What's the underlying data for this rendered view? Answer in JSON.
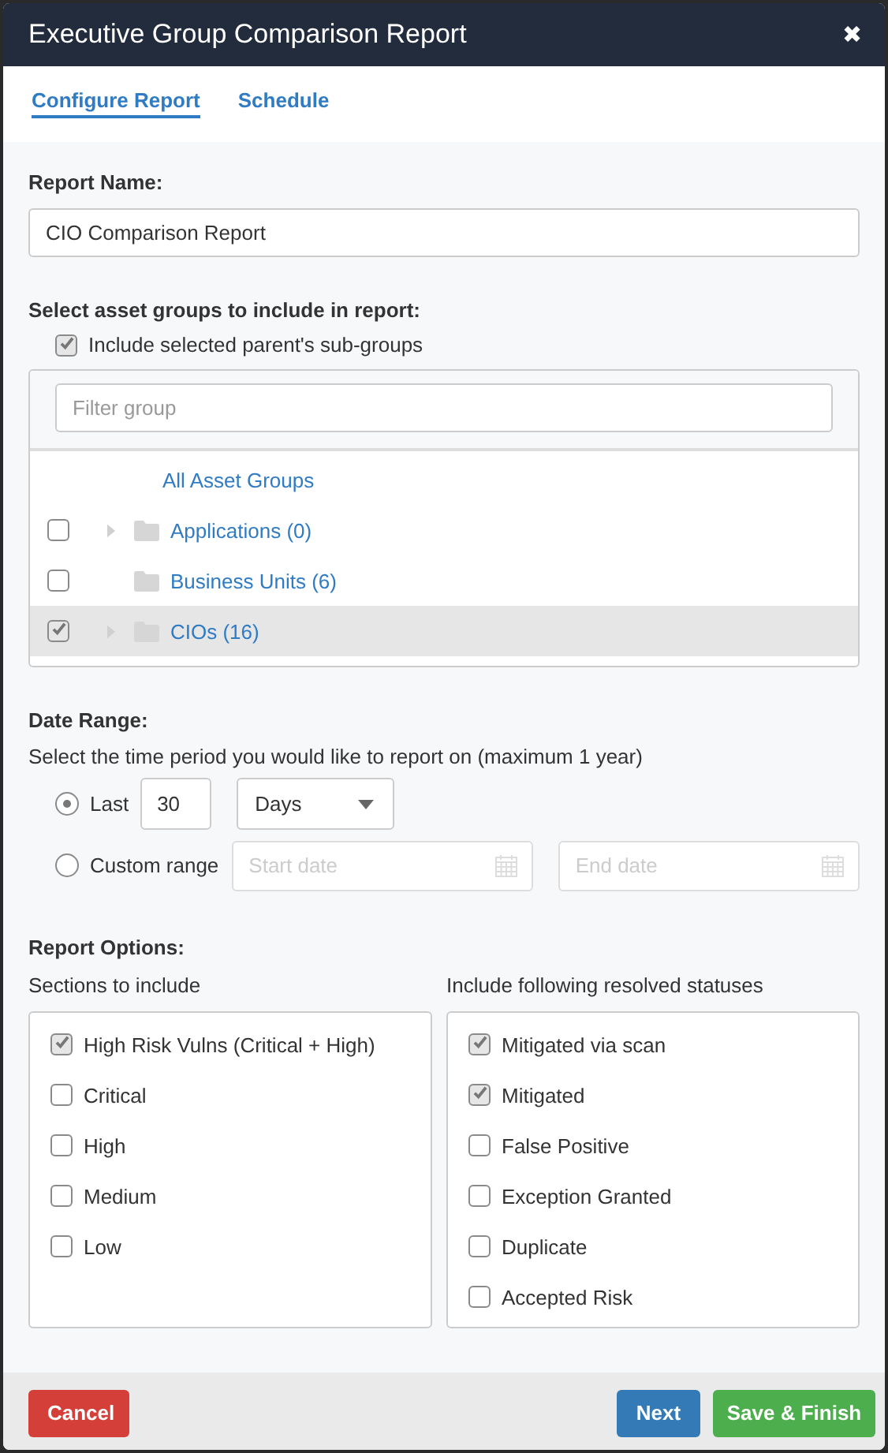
{
  "dialog": {
    "title": "Executive Group Comparison Report",
    "close": "✖"
  },
  "tabs": [
    {
      "label": "Configure Report",
      "selected": true
    },
    {
      "label": "Schedule",
      "selected": false
    }
  ],
  "report_name": {
    "label": "Report Name:",
    "value": "CIO Comparison Report"
  },
  "asset_groups": {
    "label": "Select asset groups to include in report:",
    "include_subgroups": {
      "label": "Include selected parent's sub-groups",
      "checked": true
    },
    "filter": {
      "placeholder": "Filter group"
    },
    "items": [
      {
        "kind": "root",
        "label": "All Asset Groups",
        "selected": false
      },
      {
        "kind": "group",
        "label": "Applications (0)",
        "checked": false,
        "expandable": true,
        "selected": false
      },
      {
        "kind": "group",
        "label": "Business Units (6)",
        "checked": false,
        "expandable": false,
        "selected": false
      },
      {
        "kind": "group",
        "label": "CIOs (16)",
        "checked": true,
        "expandable": true,
        "selected": true
      }
    ]
  },
  "date_range": {
    "label": "Date Range:",
    "description": "Select the time period you would like to report on (maximum 1 year)",
    "options": [
      {
        "kind": "last",
        "label": "Last",
        "selected": true,
        "amount": "30",
        "unit": "Days"
      },
      {
        "kind": "custom",
        "label": "Custom range",
        "selected": false,
        "start": {
          "placeholder": "Start date"
        },
        "end": {
          "placeholder": "End date"
        }
      }
    ]
  },
  "report_options": {
    "label": "Report Options:",
    "groups": [
      {
        "label": "Sections to include",
        "items": [
          {
            "label": "High Risk Vulns (Critical + High)",
            "checked": true
          },
          {
            "label": "Critical",
            "checked": false
          },
          {
            "label": "High",
            "checked": false
          },
          {
            "label": "Medium",
            "checked": false
          },
          {
            "label": "Low",
            "checked": false
          }
        ]
      },
      {
        "label": "Include following resolved statuses",
        "items": [
          {
            "label": "Mitigated via scan",
            "checked": true
          },
          {
            "label": "Mitigated",
            "checked": true
          },
          {
            "label": "False Positive",
            "checked": false
          },
          {
            "label": "Exception Granted",
            "checked": false
          },
          {
            "label": "Duplicate",
            "checked": false
          },
          {
            "label": "Accepted Risk",
            "checked": false
          }
        ]
      }
    ]
  },
  "footer": {
    "buttons": [
      {
        "kind": "danger",
        "label": "Cancel"
      },
      {
        "kind": "primary",
        "label": "Next"
      },
      {
        "kind": "success",
        "label": "Save & Finish"
      }
    ]
  }
}
